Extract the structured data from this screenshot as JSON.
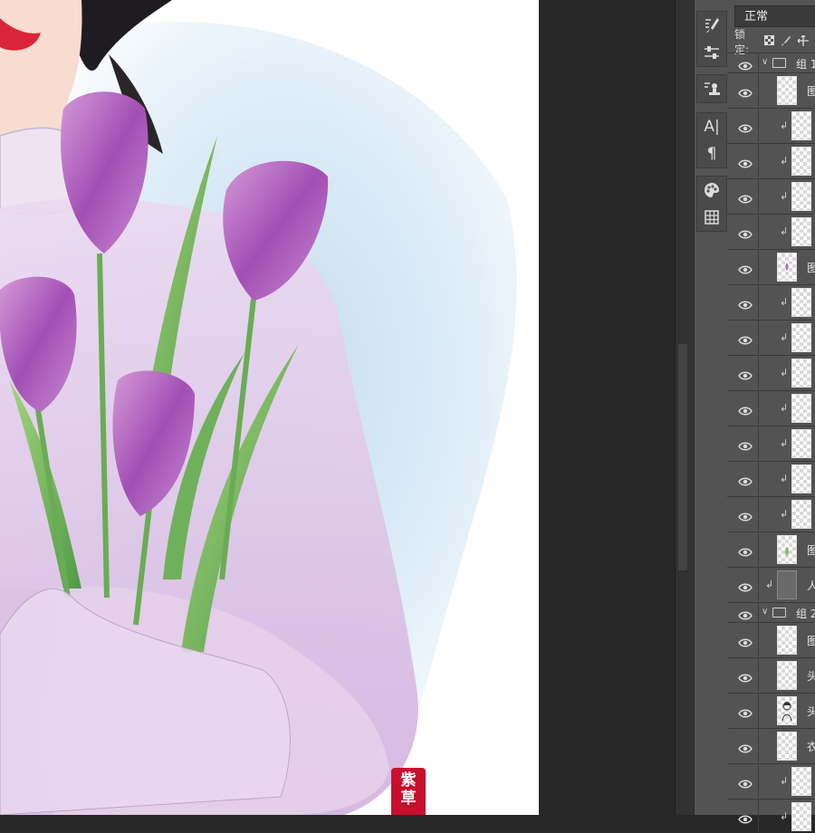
{
  "canvas": {
    "seal_text": "紫草"
  },
  "tools": {
    "groups": [
      [
        "brush-settings-icon",
        "brush-presets-icon"
      ],
      [
        "clone-source-icon"
      ],
      [
        "character-icon",
        "paragraph-icon"
      ],
      [
        "swatches-icon",
        "table-grid-icon"
      ]
    ],
    "character_glyph": "A|",
    "paragraph_glyph": "¶"
  },
  "layers_panel": {
    "blend_mode": "正常",
    "lock_label": "锁定:",
    "layers": [
      {
        "type": "group",
        "name": "组 1"
      },
      {
        "type": "layer",
        "name": "图",
        "clipped": false,
        "thumb": "blank"
      },
      {
        "type": "layer",
        "name": "",
        "clipped": true,
        "thumb": "blank"
      },
      {
        "type": "layer",
        "name": "",
        "clipped": true,
        "thumb": "blank"
      },
      {
        "type": "layer",
        "name": "",
        "clipped": true,
        "thumb": "blank"
      },
      {
        "type": "layer",
        "name": "",
        "clipped": true,
        "thumb": "blank"
      },
      {
        "type": "layer",
        "name": "图",
        "clipped": false,
        "thumb": "flower"
      },
      {
        "type": "layer",
        "name": "",
        "clipped": true,
        "thumb": "blank"
      },
      {
        "type": "layer",
        "name": "",
        "clipped": true,
        "thumb": "blank"
      },
      {
        "type": "layer",
        "name": "",
        "clipped": true,
        "thumb": "blank"
      },
      {
        "type": "layer",
        "name": "",
        "clipped": true,
        "thumb": "blank"
      },
      {
        "type": "layer",
        "name": "",
        "clipped": true,
        "thumb": "blank"
      },
      {
        "type": "layer",
        "name": "",
        "clipped": true,
        "thumb": "blank"
      },
      {
        "type": "layer",
        "name": "",
        "clipped": true,
        "thumb": "blank"
      },
      {
        "type": "layer",
        "name": "图",
        "clipped": false,
        "thumb": "leaf"
      },
      {
        "type": "layer",
        "name": "人",
        "clipped": true,
        "thumb": "gray",
        "clip_left": true
      },
      {
        "type": "group",
        "name": "组 2"
      },
      {
        "type": "layer",
        "name": "图",
        "clipped": false,
        "thumb": "blank"
      },
      {
        "type": "layer",
        "name": "头",
        "clipped": false,
        "thumb": "blank"
      },
      {
        "type": "layer",
        "name": "头",
        "clipped": false,
        "thumb": "figure"
      },
      {
        "type": "layer",
        "name": "衣",
        "clipped": false,
        "thumb": "blank"
      },
      {
        "type": "layer",
        "name": "",
        "clipped": true,
        "thumb": "blank"
      },
      {
        "type": "layer",
        "name": "",
        "clipped": true,
        "thumb": "blank"
      }
    ]
  }
}
